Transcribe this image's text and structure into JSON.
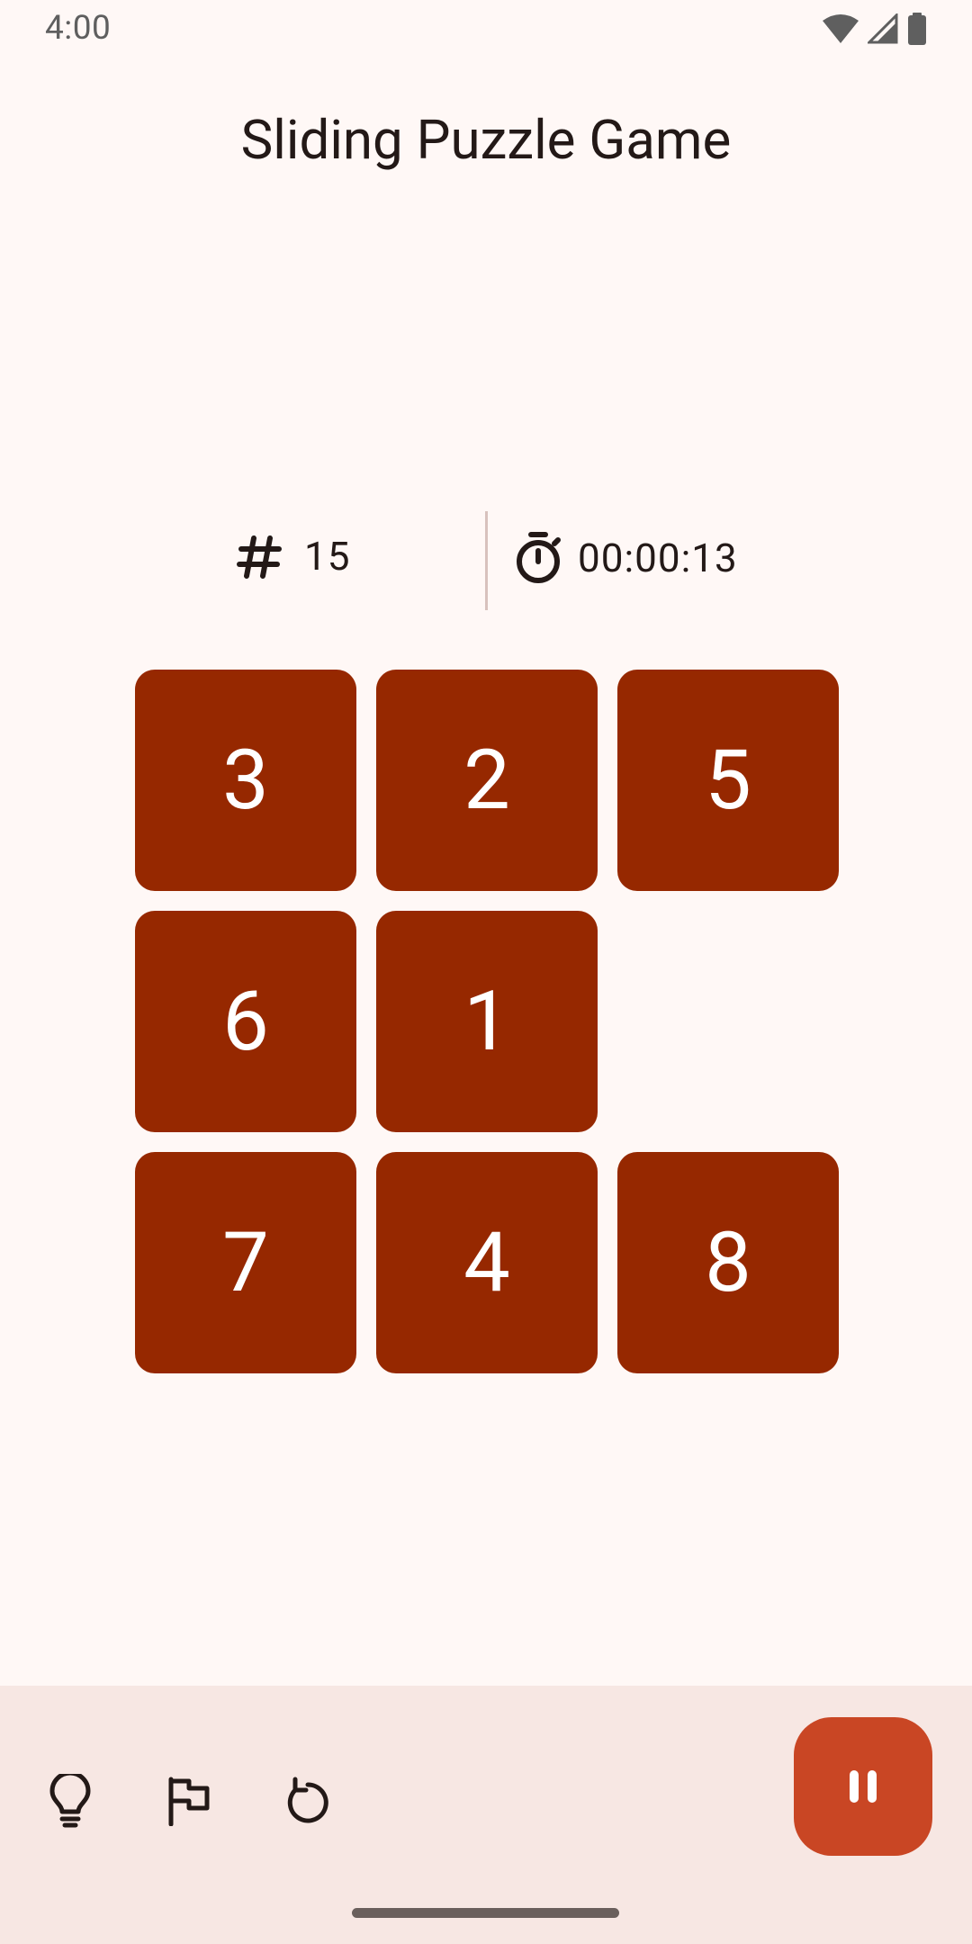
{
  "status_bar": {
    "time": "4:00"
  },
  "header": {
    "title": "Sliding Puzzle Game"
  },
  "stats": {
    "moves_icon": "hash-icon",
    "moves": "15",
    "timer_icon": "stopwatch-icon",
    "elapsed": "00:00:13"
  },
  "board": {
    "size": 3,
    "tiles": [
      [
        "3",
        "2",
        "5"
      ],
      [
        "6",
        "1",
        ""
      ],
      [
        "7",
        "4",
        "8"
      ]
    ]
  },
  "bottom_bar": {
    "actions": [
      "hint-lightbulb-icon",
      "give-up-flag-icon",
      "restart-icon"
    ],
    "fab_icon": "pause-icon"
  },
  "colors": {
    "background": "#FFF8F6",
    "tile": "#962800",
    "tile_text": "#FFFFFF",
    "bottom_bar": "#F7E7E3",
    "fab": "#C94624"
  }
}
